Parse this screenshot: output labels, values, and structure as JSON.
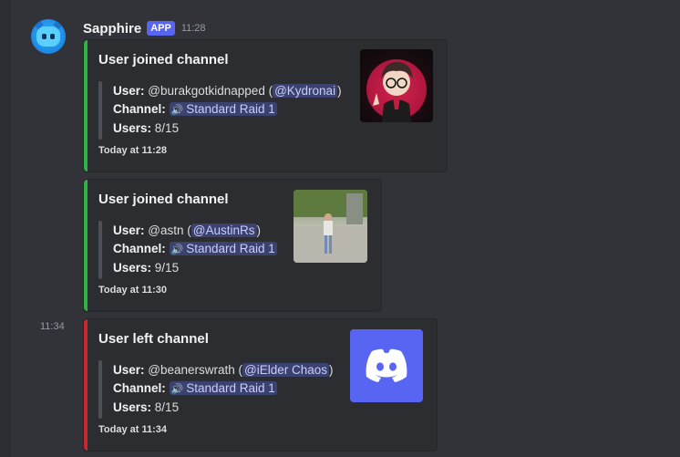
{
  "author": {
    "name": "Sapphire",
    "badge": "APP",
    "time": "11:28"
  },
  "side_time": "11:34",
  "embeds": [
    {
      "title": "User joined channel",
      "user_label": "User:",
      "user": "@burakgotkidnapped",
      "mention": "@Kydronai",
      "channel_label": "Channel:",
      "channel": "Standard Raid 1",
      "users_label": "Users:",
      "users": "8/15",
      "footer": "Today at 11:28",
      "color": "#23a55a"
    },
    {
      "title": "User joined channel",
      "user_label": "User:",
      "user": "@astn",
      "mention": "@AustinRs",
      "channel_label": "Channel:",
      "channel": "Standard Raid 1",
      "users_label": "Users:",
      "users": "9/15",
      "footer": "Today at 11:30",
      "color": "#23a55a"
    },
    {
      "title": "User left channel",
      "user_label": "User:",
      "user": "@beanerswrath",
      "mention": "@iElder Chaos",
      "channel_label": "Channel:",
      "channel": "Standard Raid 1",
      "users_label": "Users:",
      "users": "8/15",
      "footer": "Today at 11:34",
      "color": "#da373c"
    }
  ],
  "icons": {
    "speaker": "🔊",
    "discord": "discord-logo-icon"
  }
}
